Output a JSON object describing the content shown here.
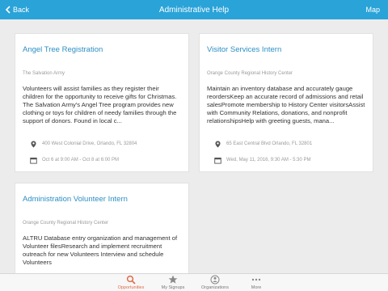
{
  "navbar": {
    "back_label": "Back",
    "title": "Administrative Help",
    "right_label": "Map"
  },
  "cards": [
    {
      "title": "Angel Tree Registration",
      "org": "The Salvation Army",
      "description": "Volunteers will assist families as they register their children for the opportunity to receive gifts for Christmas. The Salvation Army's Angel Tree program provides new clothing or toys for children of needy families through the support of donors. Found in local c...",
      "address": "400 West Colonial Drive, Orlando, FL 32804",
      "date": "Oct 6 at 9:00 AM - Oct 8 at 6:00 PM"
    },
    {
      "title": "Visitor Services Intern",
      "org": "Orange County Regional History Center",
      "description": "Maintain an inventory database and accurately gauge reordersKeep an accurate record of admissions and retail salesPromote membership to History Center visitorsAssist with Community Relations, donations, and nonprofit relationshipsHelp with greeting guests, mana...",
      "address": "65 East Central Blvd Orlando, FL 32801",
      "date": "Wed, May 11, 2016, 9:30 AM - 5:30 PM"
    },
    {
      "title": "Administration Volunteer Intern",
      "org": "Orange County Regional History Center",
      "description": "ALTRU Database entry organization and management of Volunteer filesResearch and implement recruitment outreach for new Volunteers Interview and schedule Volunteers"
    }
  ],
  "tabs": [
    {
      "label": "Opportunities",
      "icon": "search-icon",
      "active": true
    },
    {
      "label": "My Signups",
      "icon": "star-icon"
    },
    {
      "label": "Organizations",
      "icon": "organizations-icon"
    },
    {
      "label": "More",
      "icon": "more-icon"
    }
  ],
  "colors": {
    "accent": "#2aa3d8",
    "title": "#2c8fc4",
    "active_tab": "#e06b4a",
    "background": "#ececec"
  }
}
